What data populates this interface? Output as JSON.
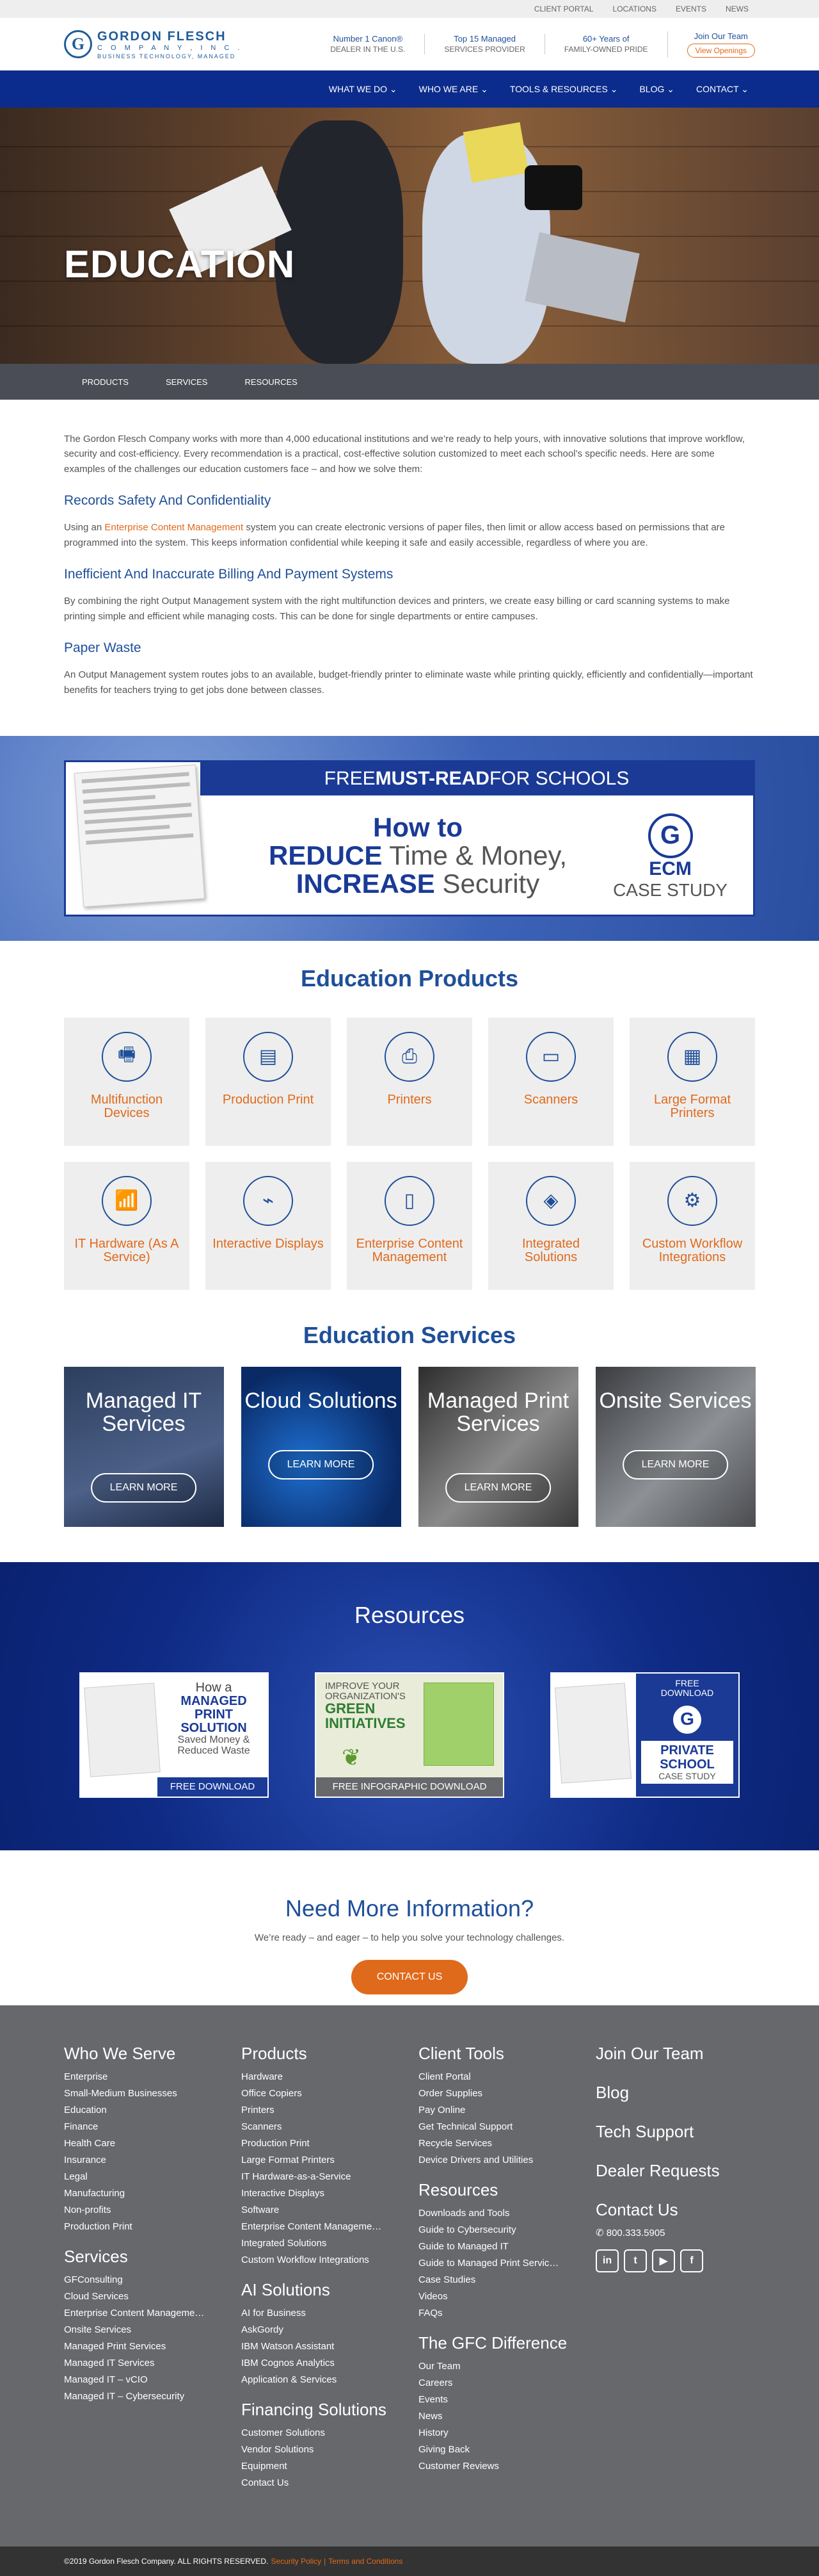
{
  "topbar": {
    "links": [
      "CLIENT PORTAL",
      "LOCATIONS",
      "EVENTS",
      "NEWS"
    ]
  },
  "logo": {
    "name": "GORDON FLESCH",
    "company": "C O M P A N Y ,  I N C .",
    "tagline": "BUSINESS TECHNOLOGY, MANAGED"
  },
  "stats": [
    {
      "title": "Number 1 Canon®",
      "sub": "DEALER IN THE U.S."
    },
    {
      "title": "Top 15 Managed",
      "sub": "SERVICES PROVIDER"
    },
    {
      "title": "60+ Years of",
      "sub": "FAMILY-OWNED PRIDE"
    }
  ],
  "join": {
    "title": "Join Our Team",
    "button": "View Openings"
  },
  "nav": [
    "WHAT WE DO",
    "WHO WE ARE",
    "TOOLS & RESOURCES",
    "BLOG",
    "CONTACT"
  ],
  "hero": {
    "title": "EDUCATION"
  },
  "subnav": [
    "PRODUCTS",
    "SERVICES",
    "RESOURCES"
  ],
  "intro": {
    "p1": "The Gordon Flesch Company works with more than 4,000 educational institutions and we’re ready to help yours, with innovative solutions that improve workflow, security and cost-efficiency. Every recommendation is a practical, cost-effective solution customized to meet each school’s specific needs. Here are some examples of the challenges our education customers face – and how we solve them:",
    "h1": "Records Safety And Confidentiality",
    "p2a": "Using an ",
    "p2link": "Enterprise Content Management",
    "p2b": " system you can create electronic versions of paper files, then limit or allow access based on permissions that are programmed into the system. This keeps information confidential while keeping it safe and easily accessible, regardless of where you are.",
    "h2": "Inefficient And Inaccurate Billing And Payment Systems",
    "p3": "By combining the right Output Management system with the right multifunction devices and printers, we create easy billing or card scanning systems to make printing simple and efficient while managing costs. This can be done for single departments or entire campuses.",
    "h3": "Paper Waste",
    "p4": "An Output Management system routes jobs to an available, budget-friendly printer to eliminate waste while printing quickly, efficiently and confidentially—important benefits for teachers trying to get jobs done between classes."
  },
  "promo": {
    "head_a": "FREE ",
    "head_b": "MUST-READ",
    "head_c": " FOR SCHOOLS",
    "l1": "How to",
    "l2a": "REDUCE",
    "l2b": " Time & Money,",
    "l3a": "INCREASE",
    "l3b": " Security",
    "case_e": "ECM",
    "case_c": "CASE STUDY"
  },
  "products": {
    "title": "Education Products",
    "items": [
      {
        "label": "Multifunction Devices",
        "icon": "mfp-icon",
        "glyph": "🖷"
      },
      {
        "label": "Production Print",
        "icon": "production-print-icon",
        "glyph": "▤"
      },
      {
        "label": "Printers",
        "icon": "printer-icon",
        "glyph": "⎙"
      },
      {
        "label": "Scanners",
        "icon": "scanner-icon",
        "glyph": "▭"
      },
      {
        "label": "Large Format Printers",
        "icon": "large-format-printer-icon",
        "glyph": "▦"
      },
      {
        "label": "IT Hardware (As A Service)",
        "icon": "router-icon",
        "glyph": "📶"
      },
      {
        "label": "Interactive Displays",
        "icon": "usb-icon",
        "glyph": "⌁"
      },
      {
        "label": "Enterprise Content Management",
        "icon": "devices-icon",
        "glyph": "▯"
      },
      {
        "label": "Integrated Solutions",
        "icon": "integration-icon",
        "glyph": "◈"
      },
      {
        "label": "Custom Workflow Integrations",
        "icon": "workflow-icon",
        "glyph": "⚙"
      }
    ]
  },
  "services": {
    "title": "Education Services",
    "items": [
      {
        "title": "Managed IT Services",
        "button": "LEARN MORE",
        "bg": "#3a4a66"
      },
      {
        "title": "Cloud Solutions",
        "button": "LEARN MORE",
        "bg": "#0a2a66"
      },
      {
        "title": "Managed Print Services",
        "button": "LEARN MORE",
        "bg": "#555555"
      },
      {
        "title": "Onsite Services",
        "button": "LEARN MORE",
        "bg": "#5a5c60"
      }
    ]
  },
  "resources": {
    "title": "Resources",
    "cards": [
      {
        "lines": [
          "How a",
          "MANAGED",
          "PRINT",
          "SOLUTION",
          "Saved Money &",
          "Reduced Waste"
        ],
        "button": "FREE DOWNLOAD",
        "color": "#1a3a96"
      },
      {
        "lines": [
          "IMPROVE YOUR",
          "ORGANIZATION'S",
          "GREEN",
          "INITIATIVES"
        ],
        "button": "FREE INFOGRAPHIC DOWNLOAD",
        "color": "#67686b"
      },
      {
        "lines": [
          "FREE",
          "DOWNLOAD",
          "PRIVATE",
          "SCHOOL",
          "CASE STUDY"
        ],
        "button": "",
        "color": "#1a3a96"
      }
    ]
  },
  "need": {
    "title": "Need More Information?",
    "text": "We’re ready – and eager – to help you solve your technology challenges.",
    "button": "CONTACT US"
  },
  "footer": {
    "who_title": "Who We Serve",
    "who": [
      "Enterprise",
      "Small-Medium Businesses",
      "Education",
      "Finance",
      "Health Care",
      "Insurance",
      "Legal",
      "Manufacturing",
      "Non-profits",
      "Production Print"
    ],
    "services_title": "Services",
    "services": [
      "GFConsulting",
      "Cloud Services",
      "Enterprise Content Manageme…",
      "Onsite Services",
      "Managed Print Services",
      "Managed IT Services",
      "Managed IT – vCIO",
      "Managed IT – Cybersecurity"
    ],
    "products_title": "Products",
    "products": [
      "Hardware",
      "Office Copiers",
      "Printers",
      "Scanners",
      "Production Print",
      "Large Format Printers",
      "IT Hardware-as-a-Service",
      "Interactive Displays",
      "Software",
      "Enterprise Content Manageme…",
      "Integrated Solutions",
      "Custom Workflow Integrations"
    ],
    "ai_title": "AI Solutions",
    "ai": [
      "AI for Business",
      "AskGordy",
      "IBM Watson Assistant",
      "IBM Cognos Analytics",
      "Application & Services"
    ],
    "fin_title": "Financing Solutions",
    "fin": [
      "Customer Solutions",
      "Vendor Solutions",
      "Equipment",
      "Contact Us"
    ],
    "client_title": "Client Tools",
    "client": [
      "Client Portal",
      "Order Supplies",
      "Pay Online",
      "Get Technical Support",
      "Recycle Services",
      "Device Drivers and Utilities"
    ],
    "res_title": "Resources",
    "res": [
      "Downloads and Tools",
      "Guide to Cybersecurity",
      "Guide to Managed IT",
      "Guide to Managed Print Servic…",
      "Case Studies",
      "Videos",
      "FAQs"
    ],
    "gfc_title": "The GFC Difference",
    "gfc": [
      "Our Team",
      "Careers",
      "Events",
      "News",
      "History",
      "Giving Back",
      "Customer Reviews"
    ],
    "right": [
      "Join Our Team",
      "Blog",
      "Tech Support",
      "Dealer Requests"
    ],
    "contact_title": "Contact Us",
    "phone": "800.333.5905",
    "social": [
      "in",
      "t",
      "▶",
      "f"
    ]
  },
  "copyright": {
    "text": "©2019 Gordon Flesch Company. ALL RIGHTS RESERVED.",
    "privacy": "Security Policy",
    "sep": "|",
    "terms": "Terms and Conditions"
  }
}
